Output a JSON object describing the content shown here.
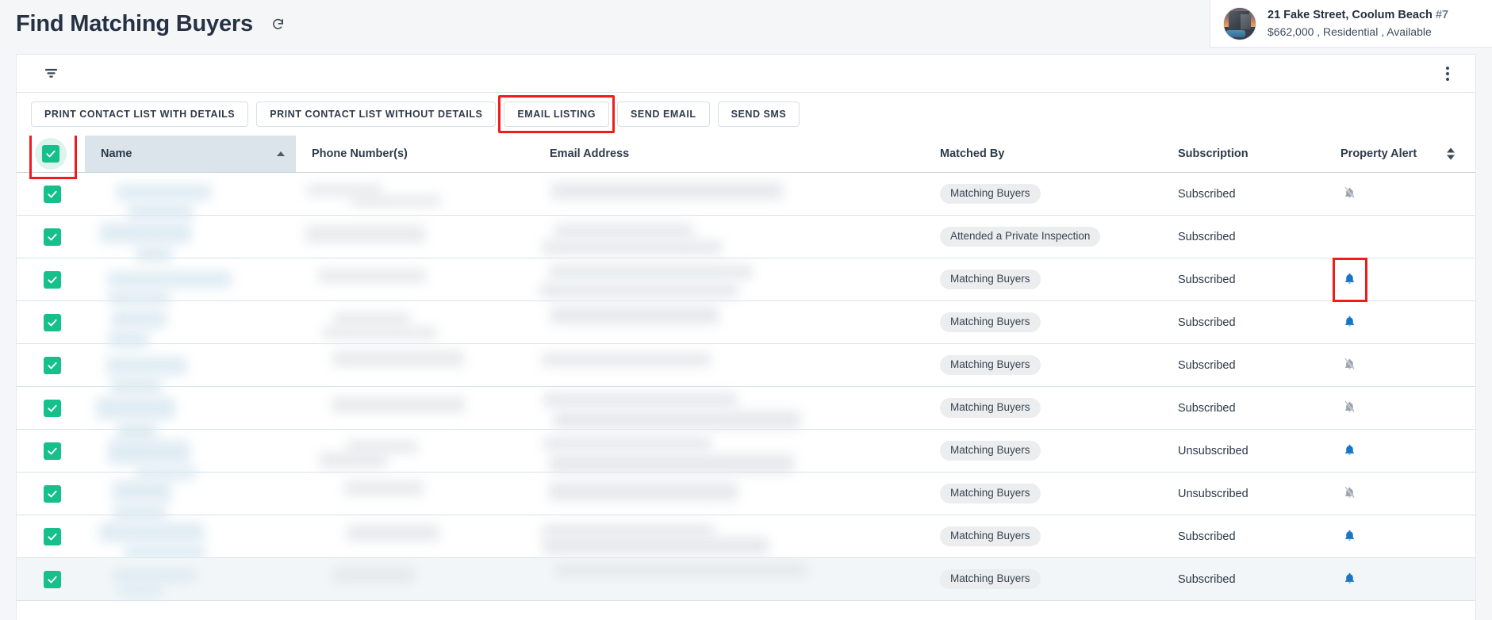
{
  "header": {
    "title": "Find Matching Buyers",
    "refresh_icon": "refresh-icon"
  },
  "property": {
    "address": "21 Fake Street, Coolum Beach",
    "listing_number": "#7",
    "details": "$662,000 , Residential , Available",
    "thumbnail_icon": "property-photo"
  },
  "toolbar": {
    "filter_icon": "filter-icon",
    "more_icon": "kebab-menu-icon",
    "buttons": [
      {
        "label": "PRINT CONTACT LIST WITH DETAILS",
        "highlighted": false
      },
      {
        "label": "PRINT CONTACT LIST WITHOUT DETAILS",
        "highlighted": false
      },
      {
        "label": "EMAIL LISTING",
        "highlighted": true
      },
      {
        "label": "SEND EMAIL",
        "highlighted": false
      },
      {
        "label": "SEND SMS",
        "highlighted": false
      }
    ]
  },
  "table": {
    "select_all_checked": true,
    "columns": {
      "name": "Name",
      "phone": "Phone Number(s)",
      "email": "Email Address",
      "matched_by": "Matched By",
      "subscription": "Subscription",
      "property_alert": "Property Alert"
    },
    "sort_column": "Name",
    "sort_direction": "asc",
    "rows": [
      {
        "checked": true,
        "matched_by": "Matching Buyers",
        "subscription": "Subscribed",
        "alert": "bell-off",
        "alert_marked": false
      },
      {
        "checked": true,
        "matched_by": "Attended a Private Inspection",
        "subscription": "Subscribed",
        "alert": "none",
        "alert_marked": false
      },
      {
        "checked": true,
        "matched_by": "Matching Buyers",
        "subscription": "Subscribed",
        "alert": "bell-on",
        "alert_marked": true
      },
      {
        "checked": true,
        "matched_by": "Matching Buyers",
        "subscription": "Subscribed",
        "alert": "bell-on",
        "alert_marked": false
      },
      {
        "checked": true,
        "matched_by": "Matching Buyers",
        "subscription": "Subscribed",
        "alert": "bell-off",
        "alert_marked": false
      },
      {
        "checked": true,
        "matched_by": "Matching Buyers",
        "subscription": "Subscribed",
        "alert": "bell-off",
        "alert_marked": false
      },
      {
        "checked": true,
        "matched_by": "Matching Buyers",
        "subscription": "Unsubscribed",
        "alert": "bell-on",
        "alert_marked": false
      },
      {
        "checked": true,
        "matched_by": "Matching Buyers",
        "subscription": "Unsubscribed",
        "alert": "bell-off",
        "alert_marked": false
      },
      {
        "checked": true,
        "matched_by": "Matching Buyers",
        "subscription": "Subscribed",
        "alert": "bell-on",
        "alert_marked": false
      },
      {
        "checked": true,
        "matched_by": "Matching Buyers",
        "subscription": "Subscribed",
        "alert": "bell-on",
        "alert_marked": false
      }
    ]
  },
  "colors": {
    "checkbox_green": "#15c08a",
    "bell_blue": "#1976c5",
    "bell_off_gray": "#9aa3ab",
    "highlight_red": "#f01c1c",
    "name_header_bg": "#dae4ea",
    "page_bg": "#f4f6f8"
  }
}
